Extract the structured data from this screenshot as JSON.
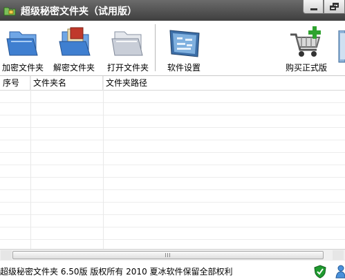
{
  "window": {
    "title": "超级秘密文件夹（试用版）",
    "icons": {
      "app": "folder-lock-icon",
      "minimize": "minimize-icon",
      "maximize": "restore-icon"
    }
  },
  "toolbar": {
    "items": [
      {
        "label": "加密文件夹",
        "icon": "encrypt-folder-icon"
      },
      {
        "label": "解密文件夹",
        "icon": "decrypt-folder-icon"
      },
      {
        "label": "打开文件夹",
        "icon": "open-folder-icon"
      },
      {
        "label": "软件设置",
        "icon": "settings-screen-icon"
      },
      {
        "label": "购买正式版",
        "icon": "shopping-cart-icon"
      }
    ]
  },
  "table": {
    "columns": [
      "序号",
      "文件夹名",
      "文件夹路径"
    ],
    "rows": []
  },
  "status": {
    "text": "超级秘密文件夹 6.50版 版权所有 2010 夏冰软件保留全部权利",
    "icons": [
      "shield-check-icon",
      "user-icon"
    ]
  },
  "colors": {
    "titlebar": "#4a4a4a",
    "folder_blue": "#3f7fd0",
    "cart_plus": "#2fa32f",
    "shield_green": "#1f9a2f"
  }
}
